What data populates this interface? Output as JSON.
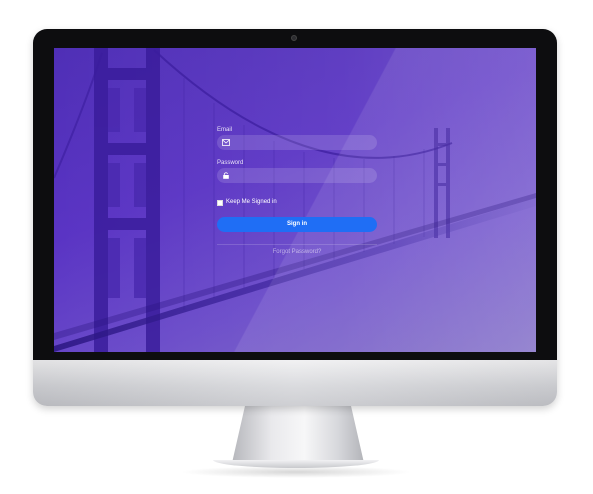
{
  "login": {
    "email_label": "Email",
    "email_value": "",
    "password_label": "Password",
    "password_value": "",
    "keep_signed_in_label": "Keep Me Signed in",
    "keep_signed_in_checked": false,
    "sign_in_label": "Sign in",
    "forgot_password_label": "Forgot Password?"
  },
  "icons": {
    "email_field": "envelope-icon",
    "password_field": "lock-icon"
  },
  "colors": {
    "screen_tint": "#5a34c4",
    "sign_in_button": "#1f6ef5"
  }
}
